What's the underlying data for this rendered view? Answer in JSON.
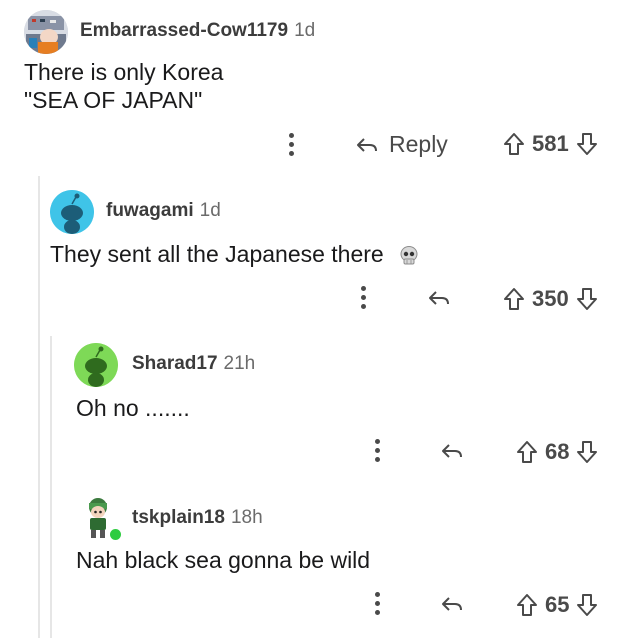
{
  "comments": [
    {
      "username": "Embarrassed-Cow1179",
      "age": "1d",
      "body_lines": [
        "There is only Korea",
        "\"SEA OF JAPAN\""
      ],
      "reply_label": "Reply",
      "score": "581",
      "avatar": "photo-avatar"
    },
    {
      "username": "fuwagami",
      "age": "1d",
      "body": "They sent all the Japanese there",
      "emoji": "skull-emoji",
      "score": "350",
      "avatar": "snoo-avatar-cyan"
    },
    {
      "username": "Sharad17",
      "age": "21h",
      "body": "Oh no .......",
      "score": "68",
      "avatar": "snoo-avatar-green"
    },
    {
      "username": "tskplain18",
      "age": "18h",
      "body": "Nah black sea gonna be wild",
      "score": "65",
      "avatar": "character-avatar-online"
    }
  ],
  "colors": {
    "text": "#1a1a1b",
    "meta": "#6b6b6b",
    "action": "#4a4a4a",
    "thread_line": "#e6e6e6",
    "avatar_cyan": "#3fc4e8",
    "avatar_green": "#7ed957",
    "online_dot": "#2ecc40"
  }
}
